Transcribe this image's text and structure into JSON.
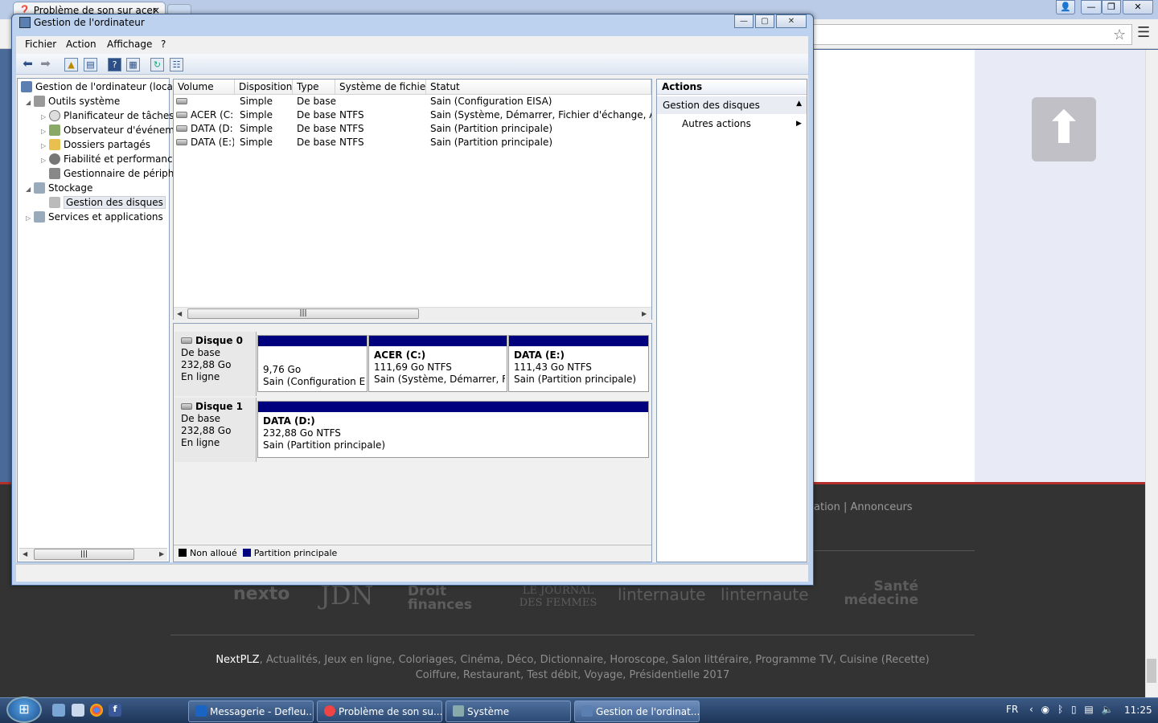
{
  "browser": {
    "tab_title": "Problème de son sur acer",
    "tab_close": "×",
    "footer_links": "ation  |  Annonceurs",
    "logos": [
      "nexto",
      "JDN",
      "Droit finances",
      "LE JOURNAL DES FEMMES",
      "linternaute",
      "linternaute",
      "Santé médecine"
    ],
    "nextplz_brand": "NextPLZ",
    "nextplz_links_1": ", Actualités, Jeux en ligne, Coloriages, Cinéma, Déco, Dictionnaire, Horoscope, Salon littéraire, Programme TV, Cuisine (Recette)",
    "nextplz_links_2": "Coiffure, Restaurant, Test débit, Voyage, Présidentielle 2017"
  },
  "window": {
    "title": "Gestion de l'ordinateur",
    "menu": [
      "Fichier",
      "Action",
      "Affichage",
      "?"
    ]
  },
  "tree": {
    "root": "Gestion de l'ordinateur (local)",
    "system_tools": "Outils système",
    "task_scheduler": "Planificateur de tâches",
    "event_viewer": "Observateur d'événeme",
    "shared_folders": "Dossiers partagés",
    "reliability": "Fiabilité et performance",
    "device_manager": "Gestionnaire de périphé",
    "storage": "Stockage",
    "disk_management": "Gestion des disques",
    "services": "Services et applications"
  },
  "list": {
    "headers": [
      "Volume",
      "Disposition",
      "Type",
      "Système de fichiers",
      "Statut"
    ],
    "rows": [
      {
        "volume": "",
        "layout": "Simple",
        "type": "De base",
        "fs": "",
        "status": "Sain (Configuration EISA)"
      },
      {
        "volume": "ACER (C:)",
        "layout": "Simple",
        "type": "De base",
        "fs": "NTFS",
        "status": "Sain (Système, Démarrer, Fichier d'échange, Actif, Vi"
      },
      {
        "volume": "DATA (D:)",
        "layout": "Simple",
        "type": "De base",
        "fs": "NTFS",
        "status": "Sain (Partition principale)"
      },
      {
        "volume": "DATA (E:)",
        "layout": "Simple",
        "type": "De base",
        "fs": "NTFS",
        "status": "Sain (Partition principale)"
      }
    ]
  },
  "disks": [
    {
      "name": "Disque 0",
      "kind": "De base",
      "size": "232,88 Go",
      "state": "En ligne",
      "partitions": [
        {
          "label": "",
          "size": "9,76 Go",
          "status": "Sain (Configuration EIS"
        },
        {
          "label": "ACER  (C:)",
          "size": "111,69 Go NTFS",
          "status": "Sain (Système, Démarrer, Fichi"
        },
        {
          "label": "DATA  (E:)",
          "size": "111,43 Go NTFS",
          "status": "Sain (Partition principale)"
        }
      ]
    },
    {
      "name": "Disque 1",
      "kind": "De base",
      "size": "232,88 Go",
      "state": "En ligne",
      "partitions": [
        {
          "label": "DATA  (D:)",
          "size": "232,88 Go NTFS",
          "status": "Sain (Partition principale)"
        }
      ]
    }
  ],
  "legend": {
    "unallocated": "Non alloué",
    "primary": "Partition principale"
  },
  "actions": {
    "title": "Actions",
    "group": "Gestion des disques",
    "more": "Autres actions"
  },
  "taskbar": {
    "tasks": [
      "Messagerie - Defleu...",
      "Problème de son su...",
      "Système",
      "Gestion de l'ordinat..."
    ],
    "lang": "FR",
    "clock": "11:25"
  },
  "colors": {
    "partition_bar": "#00007e",
    "footer_accent": "#b3302d"
  }
}
